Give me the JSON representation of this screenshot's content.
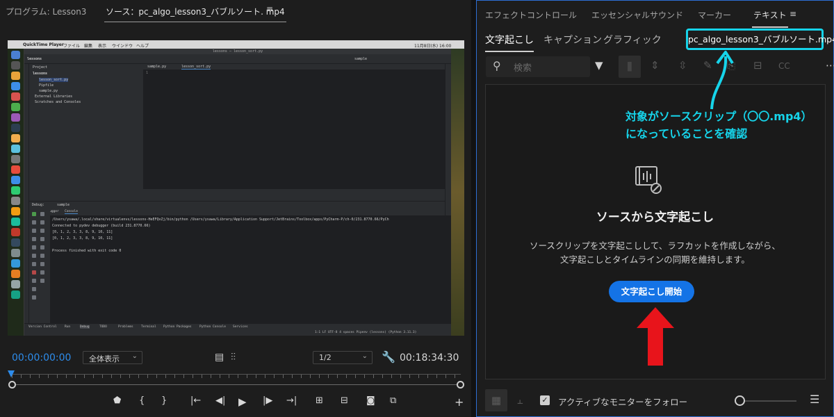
{
  "left_panel": {
    "program_tab": "プログラム: Lesson3",
    "source_tab": "ソース：pc_algo_lesson3_バブルソート. mp4",
    "menu_icon": "hamburger-icon",
    "timecode_current": "00:00:00:00",
    "zoom_select": "全体表示",
    "resolution_select": "1/2",
    "timecode_duration": "00:18:34:30",
    "video": {
      "mac_menu": [
        "QuickTime Player",
        "ファイル",
        "編集",
        "表示",
        "ウインドウ",
        "ヘルプ"
      ],
      "mac_clock": "11月8日(水) 16:00",
      "ide_title": "lessons — lesson_sort.py",
      "ide_project_root": "lessons",
      "ide_project_label": "Project",
      "ide_tabs": [
        "sample.py",
        "lesson_sort.py"
      ],
      "ide_run_config": "sample",
      "project_tree": [
        "lessons",
        "lesson_sort.py",
        "Pipfile",
        "sample.py",
        "External Libraries",
        "Scratches and Consoles"
      ],
      "editor_line": "1",
      "debug_label": "Debug:",
      "debug_config": "sample",
      "debug_tabs": [
        "Debugger",
        "Console"
      ],
      "console_lines": [
        "/Users/ysawa/.local/share/virtualenvs/lessons-HeEFQvZj/bin/python /Users/ysawa/Library/Application Support/JetBrains/Toolbox/apps/PyCharm-P/ch-0/231.8770.66/PyCh",
        "Connected to pydev debugger (build 231.8770.66)",
        "[0, 1, 2, 3, 3, 8, 9, 10, 11]",
        "[0, 1, 2, 3, 3, 8, 9, 10, 11]",
        "",
        "Process finished with exit code 0"
      ],
      "bottom_tools": [
        "Version Control",
        "Run",
        "Debug",
        "TODO",
        "Problems",
        "Terminal",
        "Python Packages",
        "Python Console",
        "Services"
      ],
      "status_bar": "1:1   LF   UTF-8   4 spaces   Pipenv (lessons) (Python 3.11.3)"
    },
    "transport_icons": [
      "marker-icon",
      "mark-in-icon",
      "mark-out-icon",
      "go-to-in-icon",
      "step-back-icon",
      "play-icon",
      "step-forward-icon",
      "go-to-out-icon",
      "insert-icon",
      "overwrite-icon",
      "camera-icon",
      "export-icon",
      "add-icon"
    ]
  },
  "right_panel": {
    "tabs": [
      "エフェクトコントロール",
      "エッセンシャルサウンド",
      "マーカー",
      "テキスト"
    ],
    "active_tab": "テキスト",
    "sub_tabs": [
      "文字起こし",
      "キャプション",
      "グラフィック"
    ],
    "source_name": "pc_algo_lesson3_バブルソート.mp4",
    "search_placeholder": "検索",
    "empty_title": "ソースから文字起こし",
    "empty_desc_line1": "ソースクリップを文字起こしして、ラフカットを作成しながら、",
    "empty_desc_line2": "文字起こしとタイムラインの同期を維持します。",
    "start_button": "文字起こし開始",
    "annotation_line1": "対象がソースクリップ（〇〇.mp4）",
    "annotation_line2": "になっていることを確認",
    "follow_label": "アクティブなモニターをフォロー",
    "follow_checked": true
  },
  "colors": {
    "accent_blue": "#1473e6",
    "annotation_cyan": "#16d4ea",
    "arrow_red": "#e8141b",
    "timecode_blue": "#2d8ceb"
  }
}
